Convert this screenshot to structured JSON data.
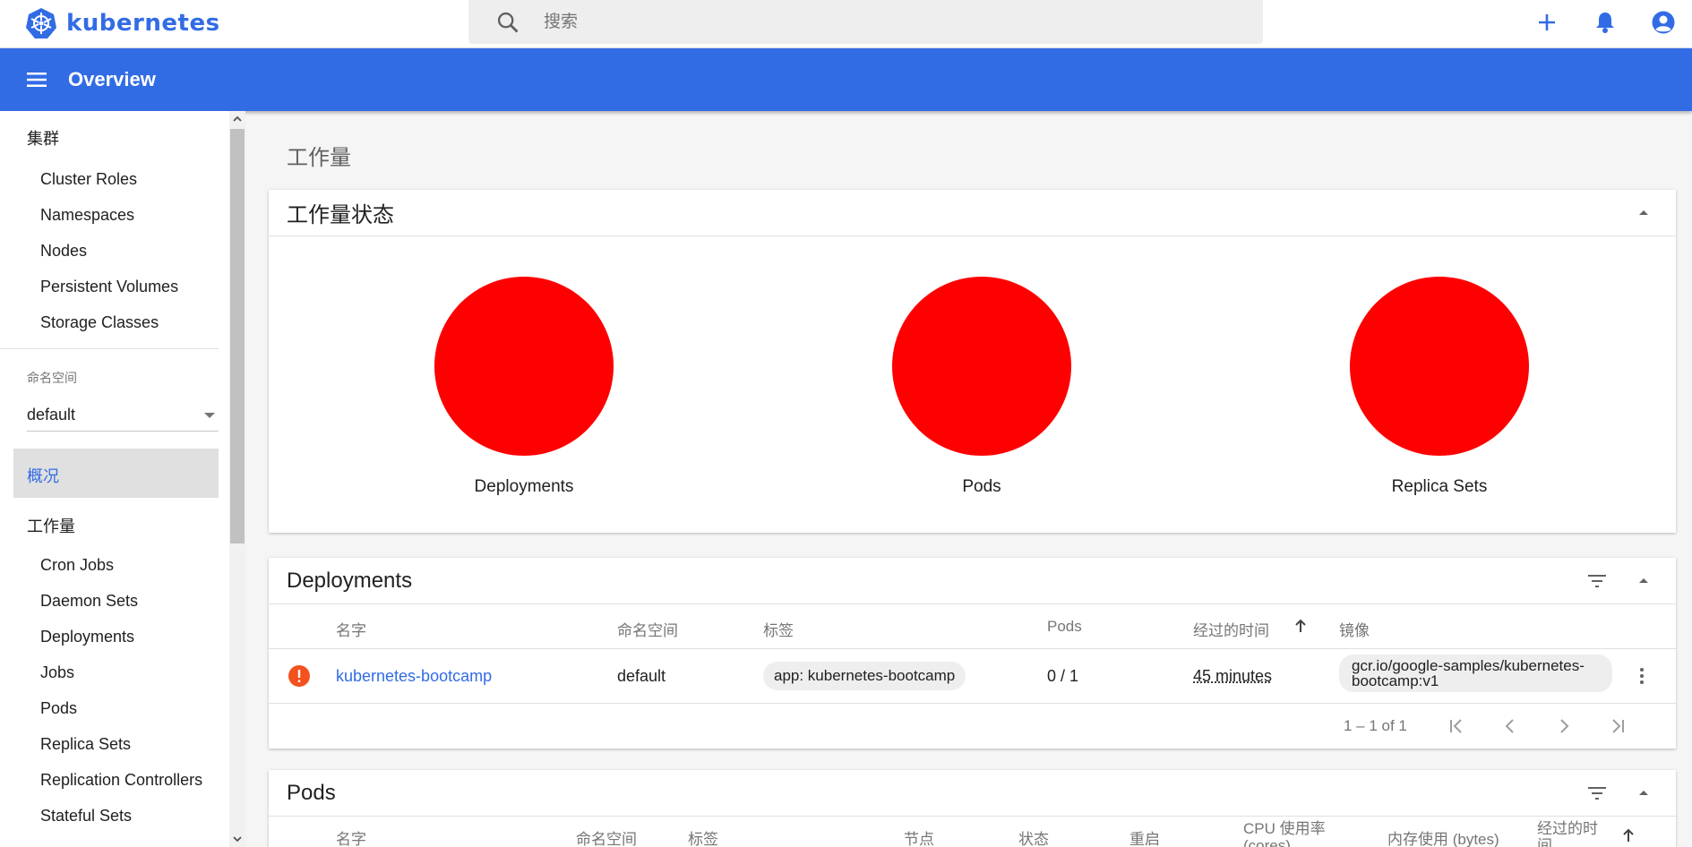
{
  "app": {
    "name": "kubernetes"
  },
  "search": {
    "placeholder": "搜索"
  },
  "toolbar": {
    "title": "Overview"
  },
  "sidebar": {
    "cluster_heading": "集群",
    "cluster_items": [
      "Cluster Roles",
      "Namespaces",
      "Nodes",
      "Persistent Volumes",
      "Storage Classes"
    ],
    "namespace_label": "命名空间",
    "namespace_value": "default",
    "overview_label": "概况",
    "workloads_heading": "工作量",
    "workload_items": [
      "Cron Jobs",
      "Daemon Sets",
      "Deployments",
      "Jobs",
      "Pods",
      "Replica Sets",
      "Replication Controllers",
      "Stateful Sets"
    ]
  },
  "main": {
    "page_title": "工作量",
    "status_card": {
      "title": "工作量状态",
      "items": [
        "Deployments",
        "Pods",
        "Replica Sets"
      ],
      "status_color": "#ff0000"
    },
    "deployments_card": {
      "title": "Deployments",
      "columns": [
        "名字",
        "命名空间",
        "标签",
        "Pods",
        "经过的时间",
        "镜像"
      ],
      "rows": [
        {
          "name": "kubernetes-bootcamp",
          "namespace": "default",
          "label": "app: kubernetes-bootcamp",
          "pods": "0 / 1",
          "age": "45 minutes",
          "image_line1": "gcr.io/google-samples/kubernetes-",
          "image_line2": "bootcamp:v1"
        }
      ],
      "pagination": "1 – 1 of 1"
    },
    "pods_card": {
      "title": "Pods",
      "columns": [
        "名字",
        "命名空间",
        "标签",
        "节点",
        "状态",
        "重启",
        "CPU 使用率",
        "内存使用 (bytes)",
        "经过的时"
      ],
      "column_cont": [
        "(cores)",
        "间"
      ]
    }
  },
  "colors": {
    "brand": "#326ce5",
    "error": "#f4511e"
  }
}
